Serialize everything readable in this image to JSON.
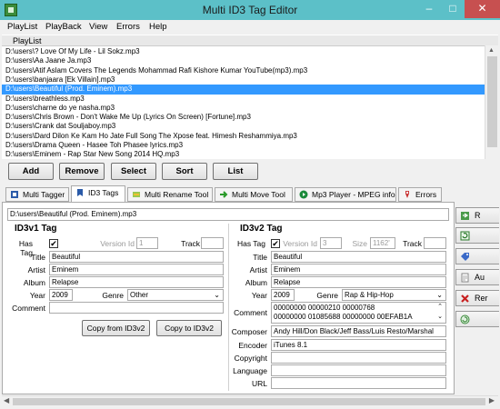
{
  "window": {
    "title": "Multi ID3 Tag Editor",
    "min_glyph": "–",
    "max_glyph": "□",
    "close_glyph": "✕"
  },
  "menu": [
    "PlayList",
    "PlayBack",
    "View",
    "Errors",
    "Help"
  ],
  "playlist": {
    "header": "PlayList",
    "items": [
      "D:\\users\\? Love Of My Life - Lil Sokz.mp3",
      "D:\\users\\Aa Jaane Ja.mp3",
      "D:\\users\\Atif Aslam Covers The Legends Mohammad Rafi Kishore Kumar YouTube(mp3).mp3",
      "D:\\users\\banjaara [Ek Villain].mp3",
      "D:\\users\\Beautiful (Prod. Eminem).mp3",
      "D:\\users\\breathless.mp3",
      "D:\\users\\charne do ye nasha.mp3",
      "D:\\users\\Chris Brown - Don't Wake Me Up (Lyrics On Screen) [Fortune].mp3",
      "D:\\users\\Crank dat Souljaboy.mp3",
      "D:\\users\\Dard Dilon Ke Kam Ho Jate Full Song The Xpose feat. Himesh Reshammiya.mp3",
      "D:\\users\\Drama Queen - Hasee Toh Phasee lyrics.mp3",
      "D:\\users\\Eminem - Rap Star New Song 2014 HQ.mp3"
    ],
    "selected_index": 4
  },
  "playlist_buttons": [
    "Add",
    "Remove",
    "Select",
    "Sort",
    "List"
  ],
  "tabs": [
    {
      "label": "Multi Tagger",
      "icon": "tag-icon",
      "color": "#2a5aa8"
    },
    {
      "label": "ID3 Tags",
      "icon": "bookmark-icon",
      "color": "#2a5aa8"
    },
    {
      "label": "Multi Rename Tool",
      "icon": "rename-tool-icon",
      "color": "#5a9a2a"
    },
    {
      "label": "Multi Move Tool",
      "icon": "move-tool-icon",
      "color": "#2a9a2a"
    },
    {
      "label": "Mp3 Player - MPEG info",
      "icon": "player-icon",
      "color": "#1a8a3a"
    },
    {
      "label": "Errors",
      "icon": "error-icon",
      "color": "#c83030"
    }
  ],
  "active_tab": 1,
  "file_path": "D:\\users\\Beautiful (Prod. Eminem).mp3",
  "id3v1": {
    "title": "ID3v1  Tag",
    "has_tag_label": "Has Tag",
    "has_tag_checked": "✔",
    "version_label": "Version Id",
    "version": "1",
    "track_label": "Track",
    "track": "",
    "title_label": "Title",
    "title_value": "Beautiful",
    "artist_label": "Artist",
    "artist": "Eminem",
    "album_label": "Album",
    "album": "Relapse",
    "year_label": "Year",
    "year": "2009",
    "genre_label": "Genre",
    "genre": "Other",
    "comment_label": "Comment",
    "comment": "",
    "copy_button": "Copy from ID3v2"
  },
  "id3v2": {
    "title": "ID3v2  Tag",
    "has_tag_label": "Has Tag",
    "has_tag_checked": "✔",
    "version_label": "Version Id",
    "version": "3",
    "size_label": "Size",
    "size": "1162'",
    "track_label": "Track",
    "track": "",
    "title_label": "Title",
    "title_value": "Beautiful",
    "artist_label": "Artist",
    "artist": "Eminem",
    "album_label": "Album",
    "album": "Relapse",
    "year_label": "Year",
    "year": "2009",
    "genre_label": "Genre",
    "genre": "Rap & Hip-Hop",
    "comment_label": "Comment",
    "comment_line1": "00000000 00000210 00000768",
    "comment_line2": "00000000 01085688 00000000 00EFAB1A",
    "composer_label": "Composer",
    "composer": "Andy Hill/Don Black/Jeff Bass/Luis Resto/Marshal",
    "encoder_label": "Encoder",
    "encoder": "iTunes 8.1",
    "copyright_label": "Copyright",
    "copyright": "",
    "language_label": "Language",
    "language": "",
    "url_label": "URL",
    "url": ""
  },
  "copy_to_button": "Copy to ID3v2",
  "right_toolbar": [
    {
      "label": "R",
      "icon": "read-icon"
    },
    {
      "label": "",
      "icon": "refresh-icon"
    },
    {
      "label": "",
      "icon": "tag-write-icon"
    },
    {
      "label": "Au",
      "icon": "auto-icon"
    },
    {
      "label": "Rer",
      "icon": "remove-tag-icon"
    },
    {
      "label": "",
      "icon": "undo-icon"
    }
  ]
}
